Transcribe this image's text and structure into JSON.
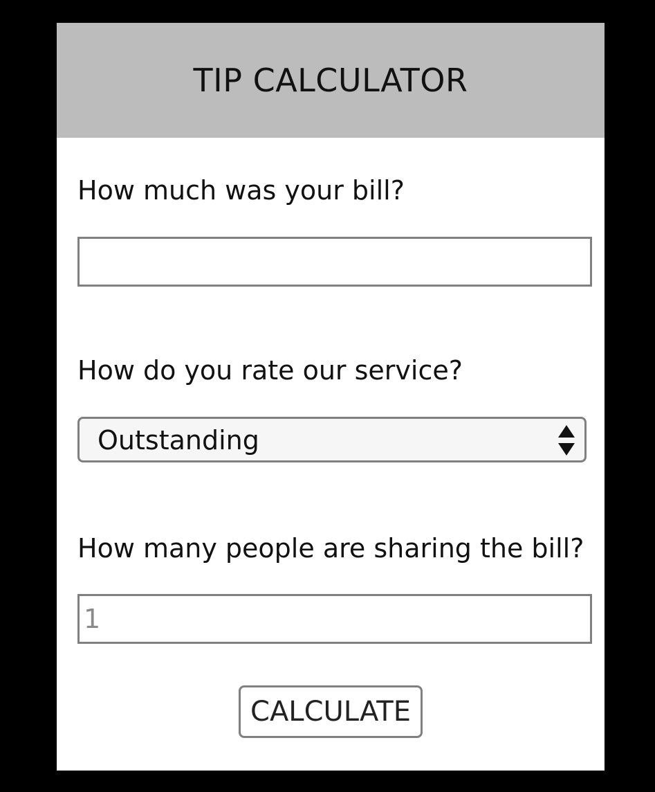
{
  "header": {
    "title": "TIP CALCULATOR"
  },
  "bill": {
    "label": "How much was your bill?",
    "value": "",
    "placeholder": ""
  },
  "service": {
    "label": "How do you rate our service?",
    "selected": "Outstanding"
  },
  "people": {
    "label": "How many people are sharing the bill?",
    "placeholder": "1"
  },
  "actions": {
    "calculate_label": "CALCULATE"
  },
  "icons": {
    "select_arrows": "up-down-arrows-icon"
  },
  "colors": {
    "background": "#000000",
    "header": "#bcbcbc",
    "card": "#ffffff",
    "border": "#808080"
  }
}
